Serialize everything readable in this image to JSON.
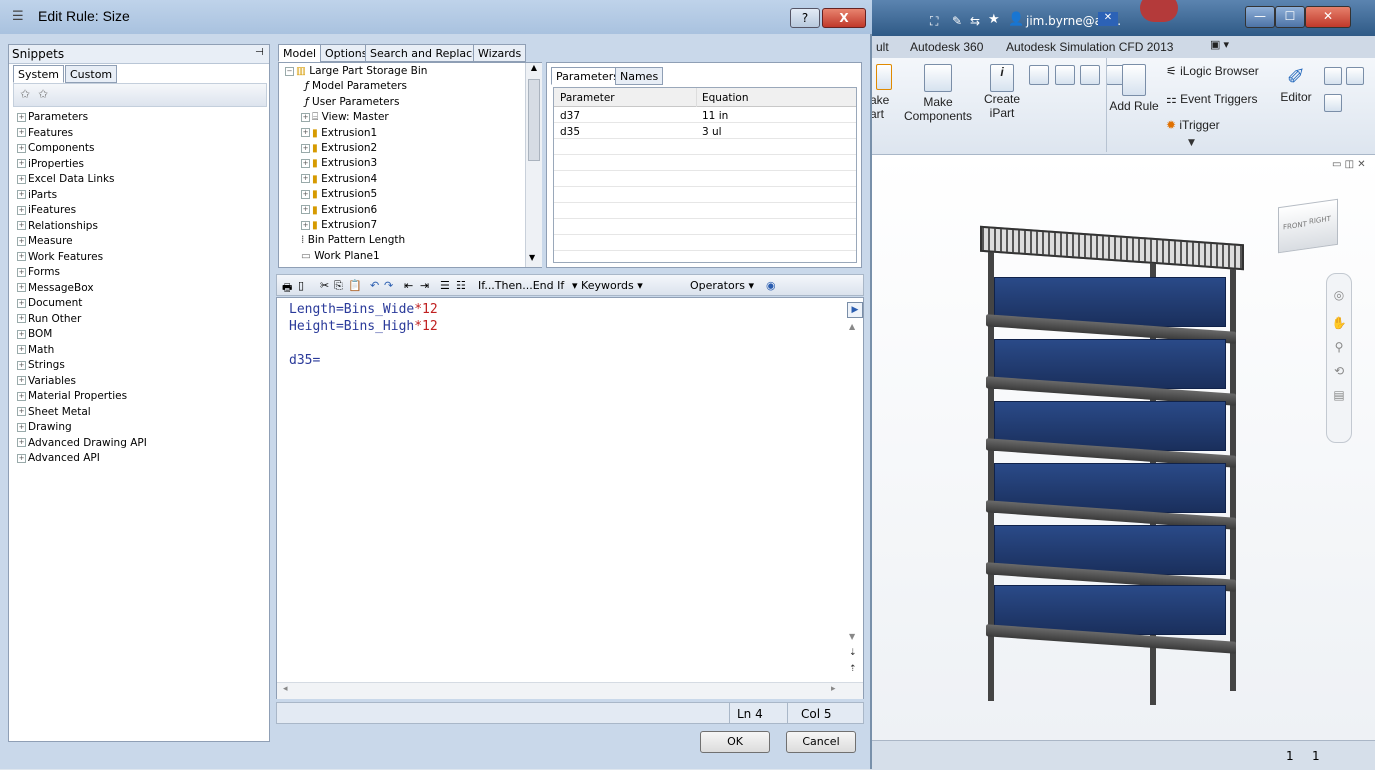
{
  "dialog": {
    "title": "Edit Rule: Size",
    "help_label": "?",
    "close_label": "X"
  },
  "snippets": {
    "header": "Snippets",
    "pin_label": "ᵽ",
    "tabs": [
      "System",
      "Custom"
    ],
    "items": [
      "Parameters",
      "Features",
      "Components",
      "iProperties",
      "Excel Data Links",
      "iParts",
      "iFeatures",
      "Relationships",
      "Measure",
      "Work Features",
      "Forms",
      "MessageBox",
      "Document",
      "Run Other",
      "BOM",
      "Math",
      "Strings",
      "Variables",
      "Material Properties",
      "Sheet Metal",
      "Drawing",
      "Advanced Drawing API",
      "Advanced API"
    ]
  },
  "model": {
    "tabs": [
      "Model",
      "Options",
      "Search and Replace",
      "Wizards"
    ],
    "tree": [
      {
        "label": "Large Part Storage Bin",
        "icon": "part-icon"
      },
      {
        "label": "Model Parameters",
        "icon": "fx-icon"
      },
      {
        "label": "User Parameters",
        "icon": "fx-icon"
      },
      {
        "label": "View: Master",
        "icon": "view-icon"
      },
      {
        "label": "Extrusion1",
        "icon": "extrusion-icon"
      },
      {
        "label": "Extrusion2",
        "icon": "extrusion-icon"
      },
      {
        "label": "Extrusion3",
        "icon": "extrusion-icon"
      },
      {
        "label": "Extrusion4",
        "icon": "extrusion-icon"
      },
      {
        "label": "Extrusion5",
        "icon": "extrusion-icon"
      },
      {
        "label": "Extrusion6",
        "icon": "extrusion-icon"
      },
      {
        "label": "Extrusion7",
        "icon": "extrusion-icon"
      },
      {
        "label": "Bin Pattern Length",
        "icon": "pattern-icon"
      },
      {
        "label": "Work Plane1",
        "icon": "workplane-icon"
      }
    ]
  },
  "params": {
    "tabs": [
      "Parameters",
      "Names"
    ],
    "headers": [
      "Parameter",
      "Equation"
    ],
    "rows": [
      [
        "d37",
        "11 in"
      ],
      [
        "d35",
        "3 ul"
      ]
    ]
  },
  "editor": {
    "toolbar": {
      "ifthen": "If...Then...End If",
      "keywords": "Keywords",
      "operators": "Operators"
    },
    "lines": [
      {
        "a": "Length=Bins_Wide",
        "b": "*12"
      },
      {
        "a": "Height=Bins_High",
        "b": "*12"
      },
      {
        "a": "",
        "b": ""
      },
      {
        "a": "d35=",
        "b": ""
      }
    ],
    "status_ln": "Ln 4",
    "status_col": "Col 5"
  },
  "buttons": {
    "ok": "OK",
    "cancel": "Cancel"
  },
  "app": {
    "title_user": "jim.byrne@au...",
    "ribbon_tabs": [
      "ult",
      "Autodesk 360",
      "Autodesk Simulation CFD 2013"
    ],
    "ribbon": {
      "make_part": "ake\nart",
      "make_components": "Make\nComponents",
      "create_ipart": "Create\niPart",
      "add_rule": "Add Rule",
      "ilogic_browser": "iLogic Browser",
      "event_triggers": "Event Triggers",
      "itrigger": "iTrigger",
      "editor": "Editor"
    },
    "viewcube_front": "FRONT",
    "viewcube_right": "RIGHT",
    "status_a": "1",
    "status_b": "1"
  },
  "colors": {
    "bin_blue": "#2a4a88",
    "code_blue": "#2a3a9a",
    "code_red": "#c02020"
  }
}
